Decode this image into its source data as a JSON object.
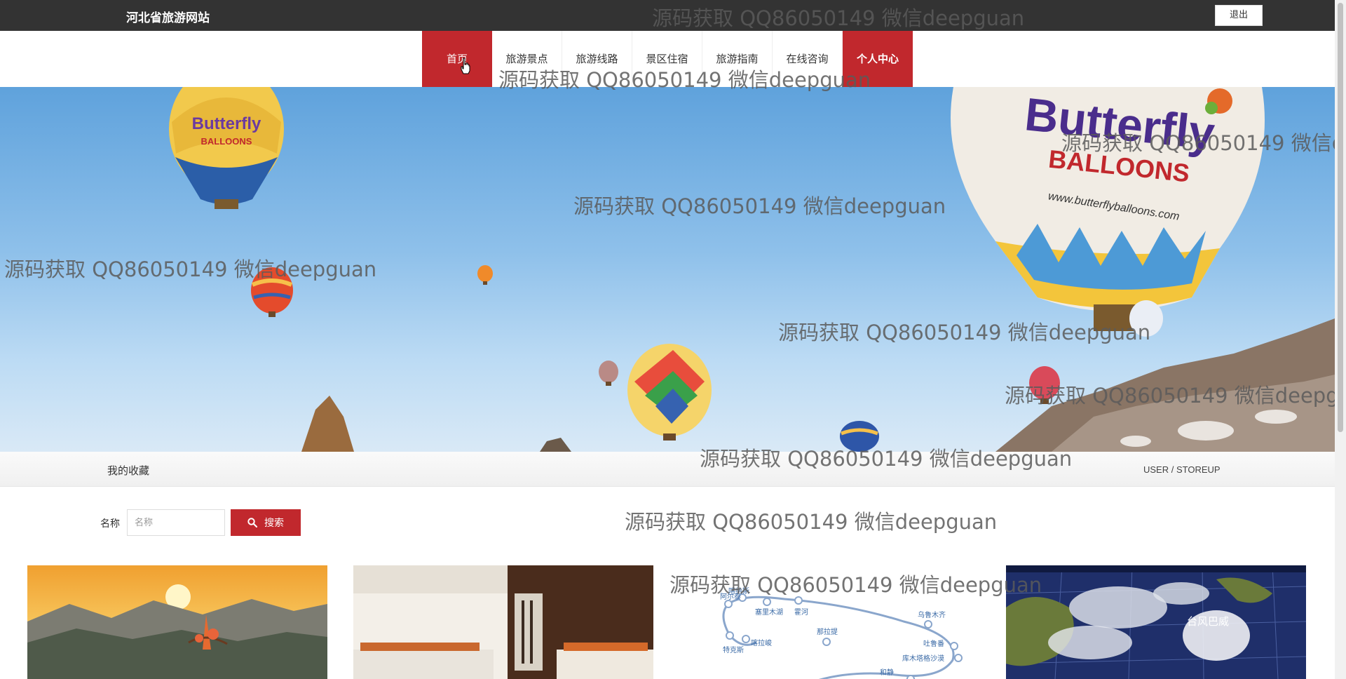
{
  "header": {
    "site_title": "河北省旅游网站",
    "logout_label": "退出"
  },
  "nav": {
    "items": [
      {
        "label": "首页",
        "active": true
      },
      {
        "label": "旅游景点"
      },
      {
        "label": "旅游线路"
      },
      {
        "label": "景区住宿"
      },
      {
        "label": "旅游指南"
      },
      {
        "label": "在线咨询"
      },
      {
        "label": "个人中心"
      }
    ]
  },
  "section": {
    "title": "我的收藏",
    "path": "USER / STOREUP"
  },
  "search": {
    "label": "名称",
    "placeholder": "名称",
    "value": "",
    "button_label": "搜索"
  },
  "watermark": {
    "text": "源码获取 QQ86050149 微信deepguan"
  },
  "banner": {
    "balloon_brand": "Butterfly",
    "balloon_sub": "BALLOONS",
    "balloon_url": "www.butterflyballoons.com",
    "small_brand": "Butterfly",
    "small_sub": "BALLOONS"
  },
  "cards": [
    {
      "name": "sunset-mountains"
    },
    {
      "name": "hotel-room"
    },
    {
      "name": "route-map",
      "stops": [
        "阿尔泰",
        "塞里木湖",
        "霍河",
        "乌鲁木齐",
        "特克斯",
        "喀拉峻",
        "那拉提",
        "吐鲁番",
        "库木塔格沙漠",
        "和静",
        "喀纳斯"
      ]
    },
    {
      "name": "satellite-weather",
      "caption": "台风巴威"
    }
  ],
  "colors": {
    "accent": "#c1282d",
    "topbar": "#333333"
  }
}
